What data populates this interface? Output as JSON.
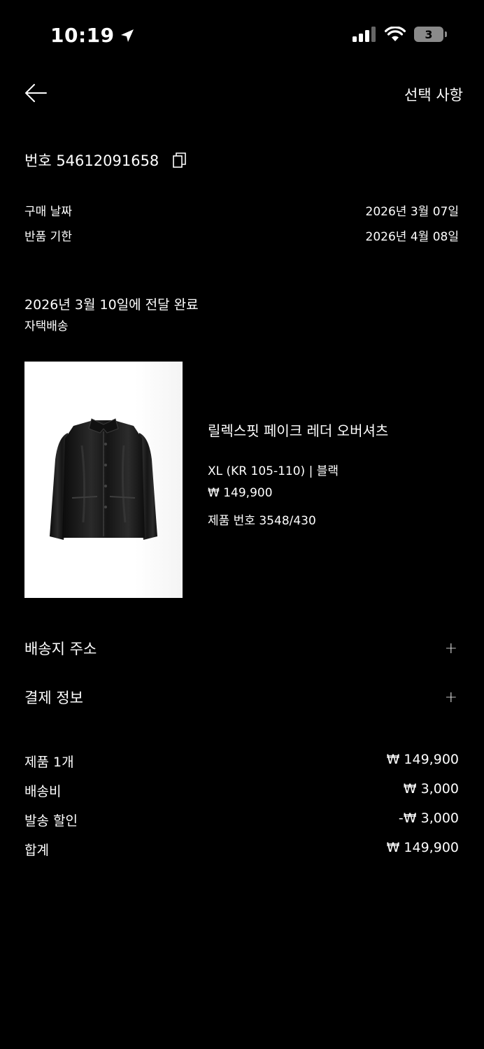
{
  "status_bar": {
    "time": "10:19",
    "battery": "3"
  },
  "header": {
    "options_label": "선택 사항"
  },
  "order": {
    "number_label": "번호 54612091658",
    "purchase_date_label": "구매 날짜",
    "purchase_date": "2026년 3월 07일",
    "return_deadline_label": "반품 기한",
    "return_deadline": "2026년 4월 08일"
  },
  "delivery": {
    "status": "2026년 3월 10일에 전달 완료",
    "method": "자택배송"
  },
  "product": {
    "name": "릴렉스핏 페이크 레더 오버셔츠",
    "size_color": "XL (KR 105-110) | 블랙",
    "price": "₩ 149,900",
    "product_number": "제품 번호 3548/430"
  },
  "sections": {
    "shipping_address": "배송지 주소",
    "payment_info": "결제 정보",
    "expand_symbol": "+"
  },
  "summary": {
    "items_label": "제품 1개",
    "items_value": "₩ 149,900",
    "shipping_label": "배송비",
    "shipping_value": "₩ 3,000",
    "discount_label": "발송 할인",
    "discount_value": "-₩ 3,000",
    "total_label": "합계",
    "total_value": "₩ 149,900"
  },
  "colors": {
    "background": "#000000",
    "text": "#ffffff",
    "product_bg": "#ffffff"
  }
}
